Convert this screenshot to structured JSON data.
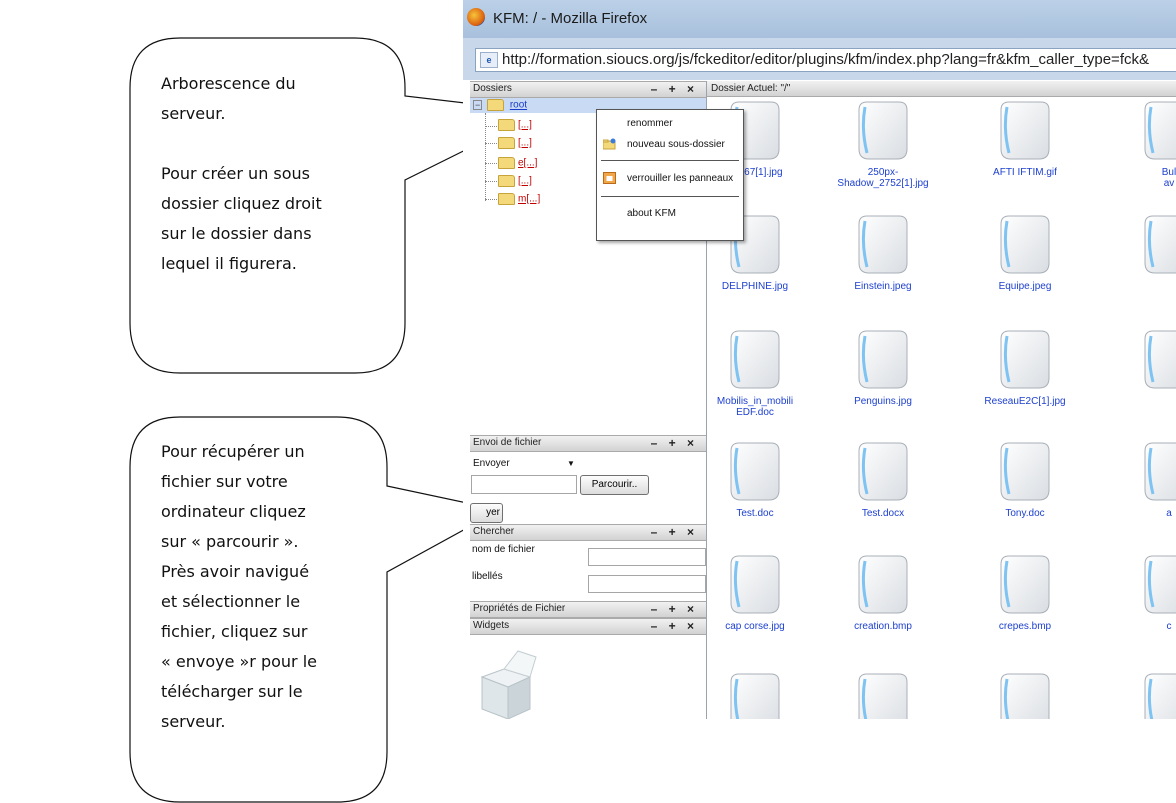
{
  "callouts": {
    "tree_text": "Arborescence du\nserveur.\n\nPour créer un sous\ndossier cliquez droit\nsur le dossier dans\nlequel il figurera.",
    "upload_text": "Pour récupérer un\nfichier sur votre\nordinateur cliquez\nsur « parcourir ».\nPrès avoir navigué\net sélectionner le\nfichier, cliquez sur\n« envoye »r pour le\ntélécharger sur le\nserveur."
  },
  "window": {
    "title": "KFM: / - Mozilla Firefox",
    "url": "http://formation.sioucs.org/js/fckeditor/editor/plugins/kfm/index.php?lang=fr&kfm_caller_type=fck&"
  },
  "dossiers": {
    "title": "Dossiers",
    "controls": "– + ×",
    "root": "root",
    "children": [
      "[...]",
      "[...]",
      "e[...]",
      "[...]",
      "m[...]"
    ]
  },
  "context_menu": {
    "items": [
      "renommer",
      "nouveau sous-dossier",
      "verrouiller les panneaux",
      "about KFM"
    ]
  },
  "upload": {
    "title": "Envoi de fichier",
    "controls": "– + ×",
    "mode": "Envoyer",
    "browse": "Parcourir..",
    "send_partial": "yer"
  },
  "search": {
    "title": "Chercher",
    "controls": "– + ×",
    "filename_label": "nom de fichier",
    "tags_label": "libellés"
  },
  "file_props": {
    "title": "Propriétés de Fichier",
    "controls": "– + ×"
  },
  "widgets": {
    "title": "Widgets",
    "controls": "– + ×"
  },
  "current_dir": "Dossier Actuel: \"/\"",
  "files": [
    [
      "14667[1].jpg",
      "250px-\nShadow_2752[1].jpg",
      "AFTI IFTIM.gif",
      "Bul\nav"
    ],
    [
      "DELPHINE.jpg",
      "Einstein.jpeg",
      "Equipe.jpeg",
      ""
    ],
    [
      "Mobilis_in_mobili\nEDF.doc",
      "Penguins.jpg",
      "ReseauE2C[1].jpg",
      ""
    ],
    [
      "Test.doc",
      "Test.docx",
      "Tony.doc",
      "a"
    ],
    [
      "cap corse.jpg",
      "creation.bmp",
      "crepes.bmp",
      "c"
    ],
    [
      "",
      "",
      "",
      ""
    ]
  ]
}
